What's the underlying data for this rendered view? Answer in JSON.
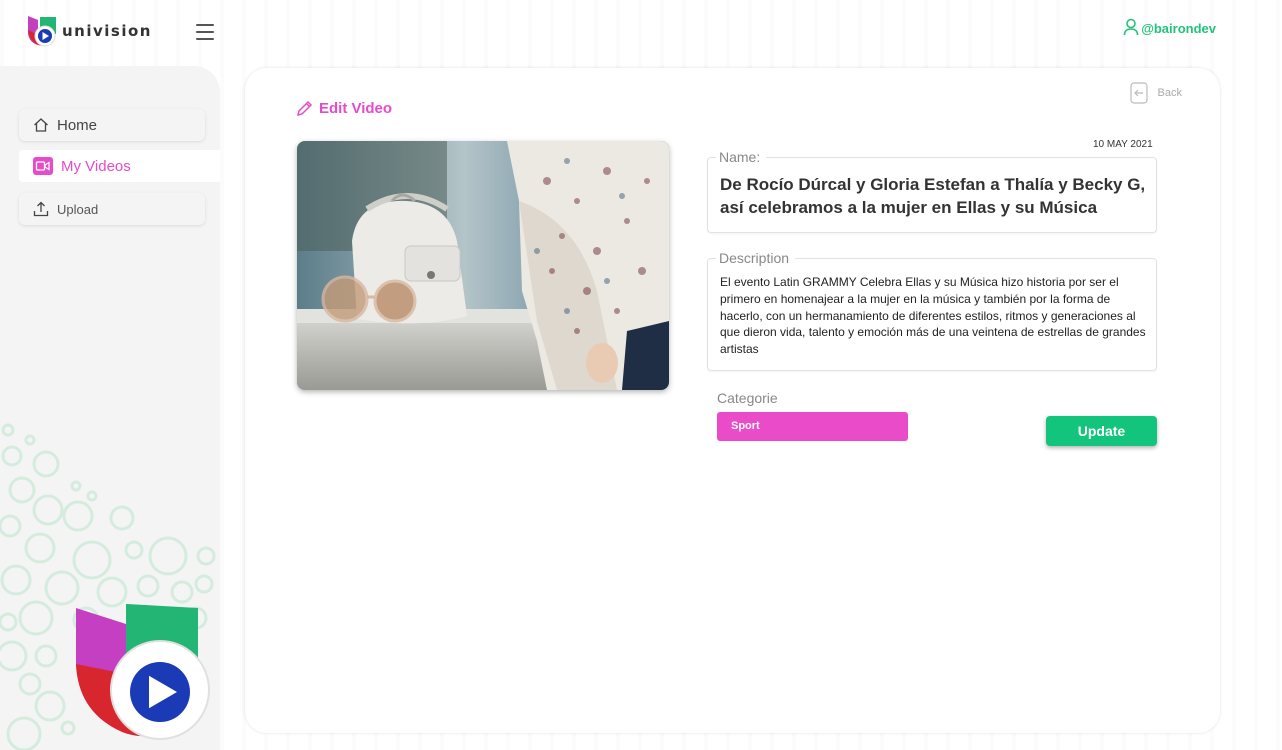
{
  "header": {
    "brand": "univision",
    "username": "@bairondev"
  },
  "sidebar": {
    "items": [
      {
        "label": "Home"
      },
      {
        "label": "My Videos"
      },
      {
        "label": "Upload"
      }
    ]
  },
  "main": {
    "title": "Edit Video",
    "back_label": "Back",
    "date": "10 MAY 2021",
    "name_label": "Name:",
    "name_value": "De Rocío Dúrcal y Gloria Estefan a Thalía y Becky G, así celebramos a la mujer en Ellas y su Música",
    "description_label": "Description",
    "description_value": "El evento Latin GRAMMY Celebra Ellas y su Música hizo historia por ser el primero en homenajear a la mujer en la música y también por la forma de hacerlo, con un hermanamiento de diferentes estilos, ritmos y generaciones al que dieron vida, talento y emoción más de una veintena de estrellas de grandes artistas",
    "category_label": "Categorie",
    "category_value": "Sport",
    "update_label": "Update"
  },
  "colors": {
    "accent_pink": "#e64bc8",
    "accent_green": "#12c47c",
    "brand_blue": "#1a3bb5",
    "brand_red": "#d8262f"
  }
}
